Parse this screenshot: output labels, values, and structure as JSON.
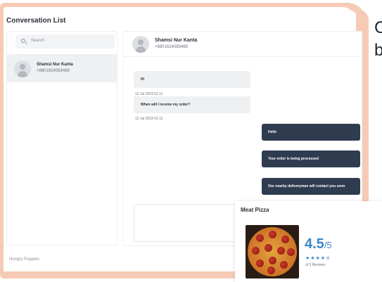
{
  "app": {
    "title": "Conversation List",
    "brand": "Hungry Puppets"
  },
  "search": {
    "placeholder": "Search"
  },
  "conversations": [
    {
      "name": "Shamsi Nur Kanta",
      "phone": "+8801624083469"
    }
  ],
  "chat": {
    "header": {
      "name": "Shamsi Nur Kanta",
      "phone": "+8801624083469"
    },
    "incoming": [
      {
        "text": "Hi",
        "time": "12 Jul 2023 01:11"
      },
      {
        "text": "When will I receive my order?",
        "time": "12 Jul 2023 01:11"
      }
    ],
    "outgoing": [
      {
        "text": "Hello"
      },
      {
        "text": "Your order is being processed"
      },
      {
        "text": "Our nearby deliveryman will contact you soon"
      }
    ]
  },
  "edge": {
    "line1": "C",
    "line2": "b"
  },
  "product": {
    "name": "Meat Pizza",
    "rating": "4.5",
    "rating_max": "/5",
    "stars": "★★★★✯",
    "reviews": "of 3 Reviews"
  },
  "colors": {
    "accent": "#3d86c6",
    "frame": "#f6cbb6",
    "outgoing_bubble": "#2f3b4f"
  }
}
